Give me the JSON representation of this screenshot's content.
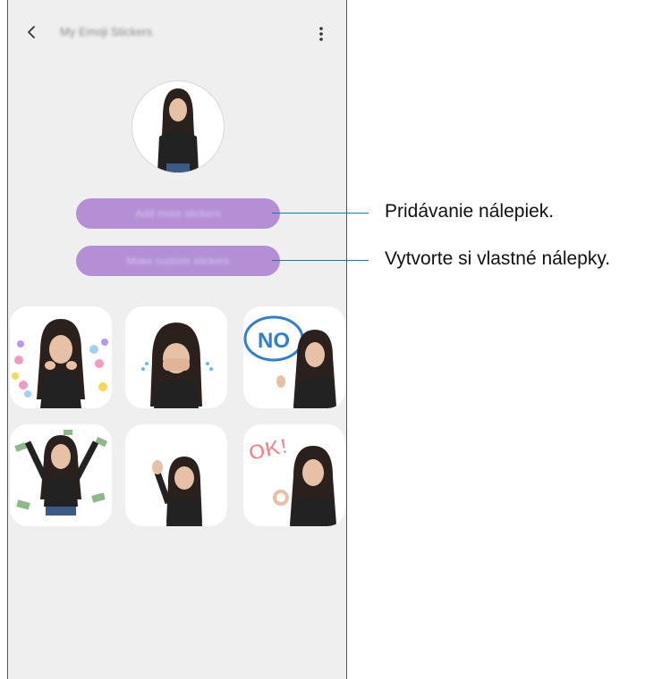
{
  "header": {
    "title": "My Emoji Stickers",
    "back_icon": "chevron-left-icon",
    "menu_icon": "more-vertical-icon"
  },
  "buttons": {
    "add_more": "Add more stickers",
    "make_custom": "Make custom stickers",
    "color": "#b48fd6"
  },
  "callouts": {
    "add_more": "Pridávanie nálepiek.",
    "make_custom": "Vytvorte si vlastné nálepky.",
    "line_color": "#0d7fa8"
  },
  "stickers": [
    {
      "name": "hearts"
    },
    {
      "name": "crying"
    },
    {
      "name": "no"
    },
    {
      "name": "money"
    },
    {
      "name": "wave"
    },
    {
      "name": "ok"
    }
  ],
  "sticker_text": {
    "no": "NO",
    "ok": "OK!"
  }
}
